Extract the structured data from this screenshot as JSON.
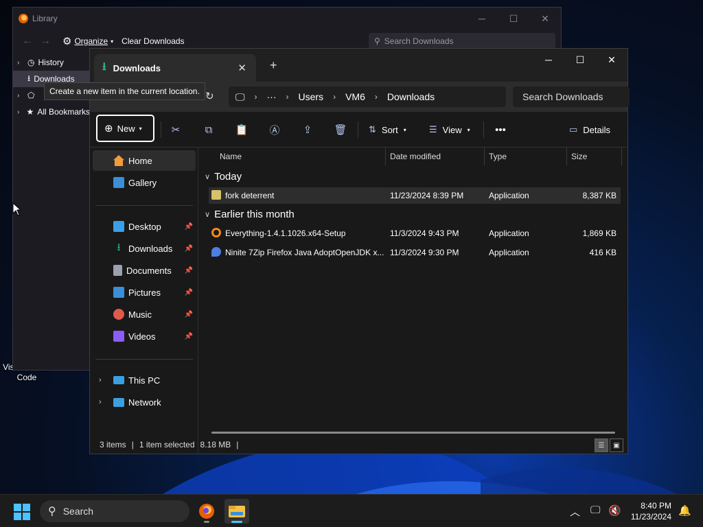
{
  "desktop": {
    "icons": [
      {
        "label": "Visual Studio Code",
        "line1": "Visual Studio",
        "line2": "Code"
      }
    ]
  },
  "library": {
    "title": "Library",
    "organize_label": "Organize",
    "clear_label": "Clear Downloads",
    "search_placeholder": "Search Downloads",
    "tree": [
      {
        "label": "History"
      },
      {
        "label": "Downloads"
      },
      {
        "label": "Tags"
      },
      {
        "label": "All Bookmarks"
      }
    ]
  },
  "tooltip": {
    "text": "Create a new item in the current location."
  },
  "explorer": {
    "tab_title": "Downloads",
    "breadcrumb": [
      "Users",
      "VM6",
      "Downloads"
    ],
    "search_placeholder": "Search Downloads",
    "commands": {
      "new_label": "New",
      "sort_label": "Sort",
      "view_label": "View",
      "details_label": "Details"
    },
    "nav": {
      "top": [
        {
          "label": "Home",
          "icon": "home-icon",
          "color": "#f29b3a"
        },
        {
          "label": "Gallery",
          "icon": "gallery-icon",
          "color": "#3a8fd8"
        }
      ],
      "pinned": [
        {
          "label": "Desktop",
          "icon": "desktop-folder-icon",
          "color": "#3a9ee8"
        },
        {
          "label": "Downloads",
          "icon": "downloads-folder-icon",
          "color": "#2db57a"
        },
        {
          "label": "Documents",
          "icon": "documents-folder-icon",
          "color": "#9aa3ad"
        },
        {
          "label": "Pictures",
          "icon": "pictures-folder-icon",
          "color": "#3a8fd8"
        },
        {
          "label": "Music",
          "icon": "music-folder-icon",
          "color": "#e05a4b"
        },
        {
          "label": "Videos",
          "icon": "videos-folder-icon",
          "color": "#8b5cf6"
        }
      ],
      "bottom": [
        {
          "label": "This PC",
          "icon": "this-pc-icon",
          "color": "#3aa0e0"
        },
        {
          "label": "Network",
          "icon": "network-icon",
          "color": "#3aa0e0"
        }
      ]
    },
    "columns": [
      "Name",
      "Date modified",
      "Type",
      "Size"
    ],
    "groups": [
      {
        "label": "Today",
        "files": [
          {
            "name": "fork deterrent",
            "date": "11/23/2024 8:39 PM",
            "type": "Application",
            "size": "8,387 KB",
            "selected": true,
            "icon_color": "#d9c36a"
          }
        ]
      },
      {
        "label": "Earlier this month",
        "files": [
          {
            "name": "Everything-1.4.1.1026.x64-Setup",
            "date": "11/3/2024 9:43 PM",
            "type": "Application",
            "size": "1,869 KB",
            "selected": false,
            "icon_color": "#f28a1e"
          },
          {
            "name": "Ninite 7Zip Firefox Java AdoptOpenJDK x...",
            "date": "11/3/2024 9:30 PM",
            "type": "Application",
            "size": "416 KB",
            "selected": false,
            "icon_color": "#4d7fe0"
          }
        ]
      }
    ],
    "status": {
      "items": "3 items",
      "selected": "1 item selected",
      "size": "8.18 MB"
    }
  },
  "taskbar": {
    "search_placeholder": "Search",
    "time": "8:40 PM",
    "date": "11/23/2024",
    "accent": "#4cc2ff"
  }
}
